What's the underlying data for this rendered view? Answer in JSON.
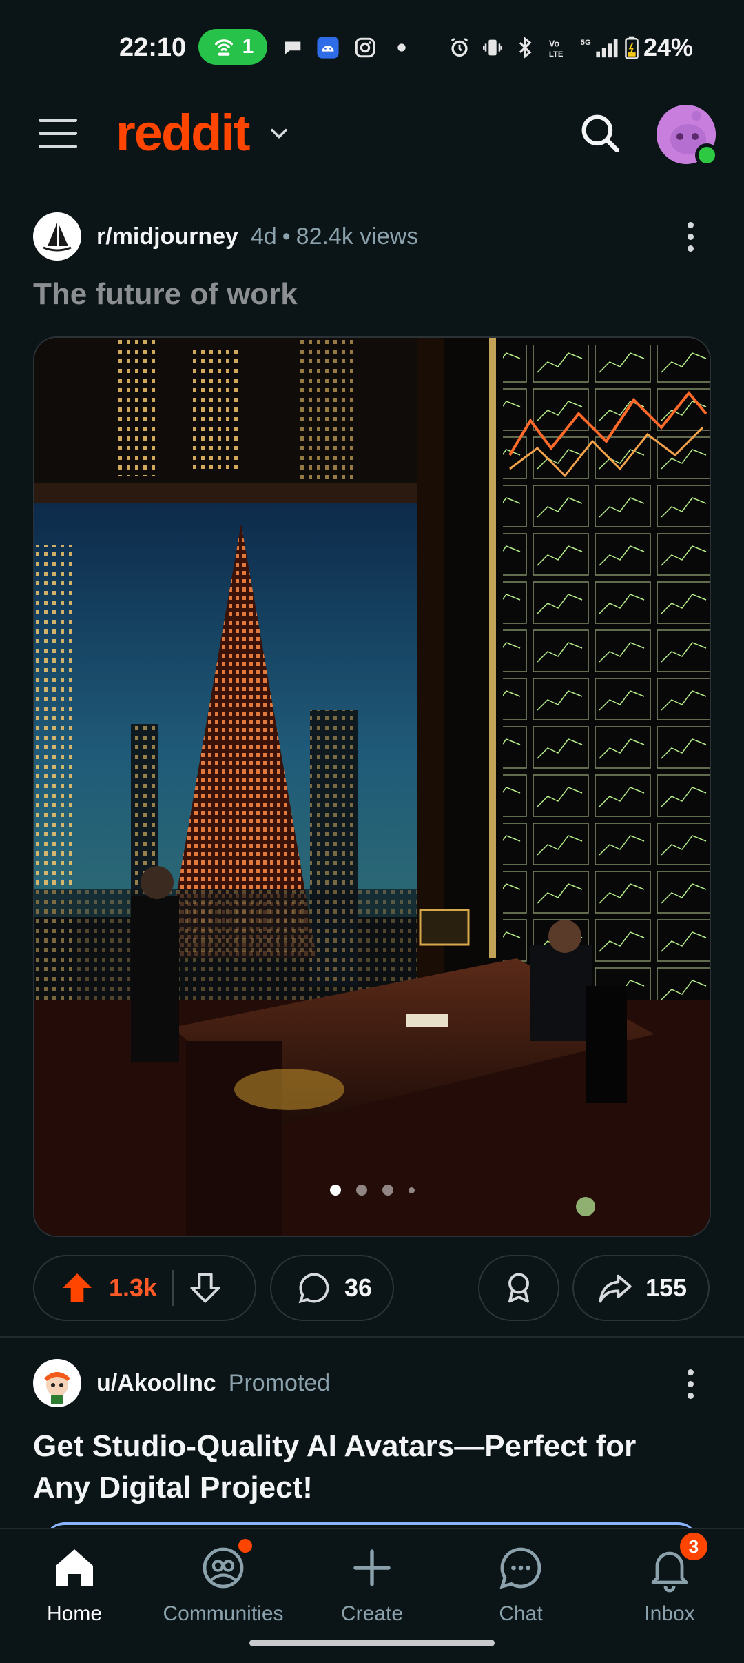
{
  "status_bar": {
    "time": "22:10",
    "hotspot_count": "1",
    "battery": "24%",
    "network": "5G"
  },
  "header": {
    "logo": "reddit"
  },
  "post": {
    "subreddit": "r/midjourney",
    "age": "4d",
    "views": "82.4k views",
    "title": "The future of work",
    "carousel": {
      "total": 4,
      "current": 1
    },
    "upvotes": "1.3k",
    "comments": "36",
    "shares": "155"
  },
  "promoted": {
    "user": "u/AkoolInc",
    "tag": "Promoted",
    "title": "Get Studio-Quality AI Avatars—Perfect for Any Digital Project!"
  },
  "nav": {
    "home": "Home",
    "communities": "Communities",
    "create": "Create",
    "chat": "Chat",
    "inbox": "Inbox",
    "inbox_badge": "3"
  },
  "colors": {
    "background": "#0b1416",
    "brand": "#ff4500",
    "upvote_active": "#ff5a27",
    "hotspot": "#26c249"
  }
}
